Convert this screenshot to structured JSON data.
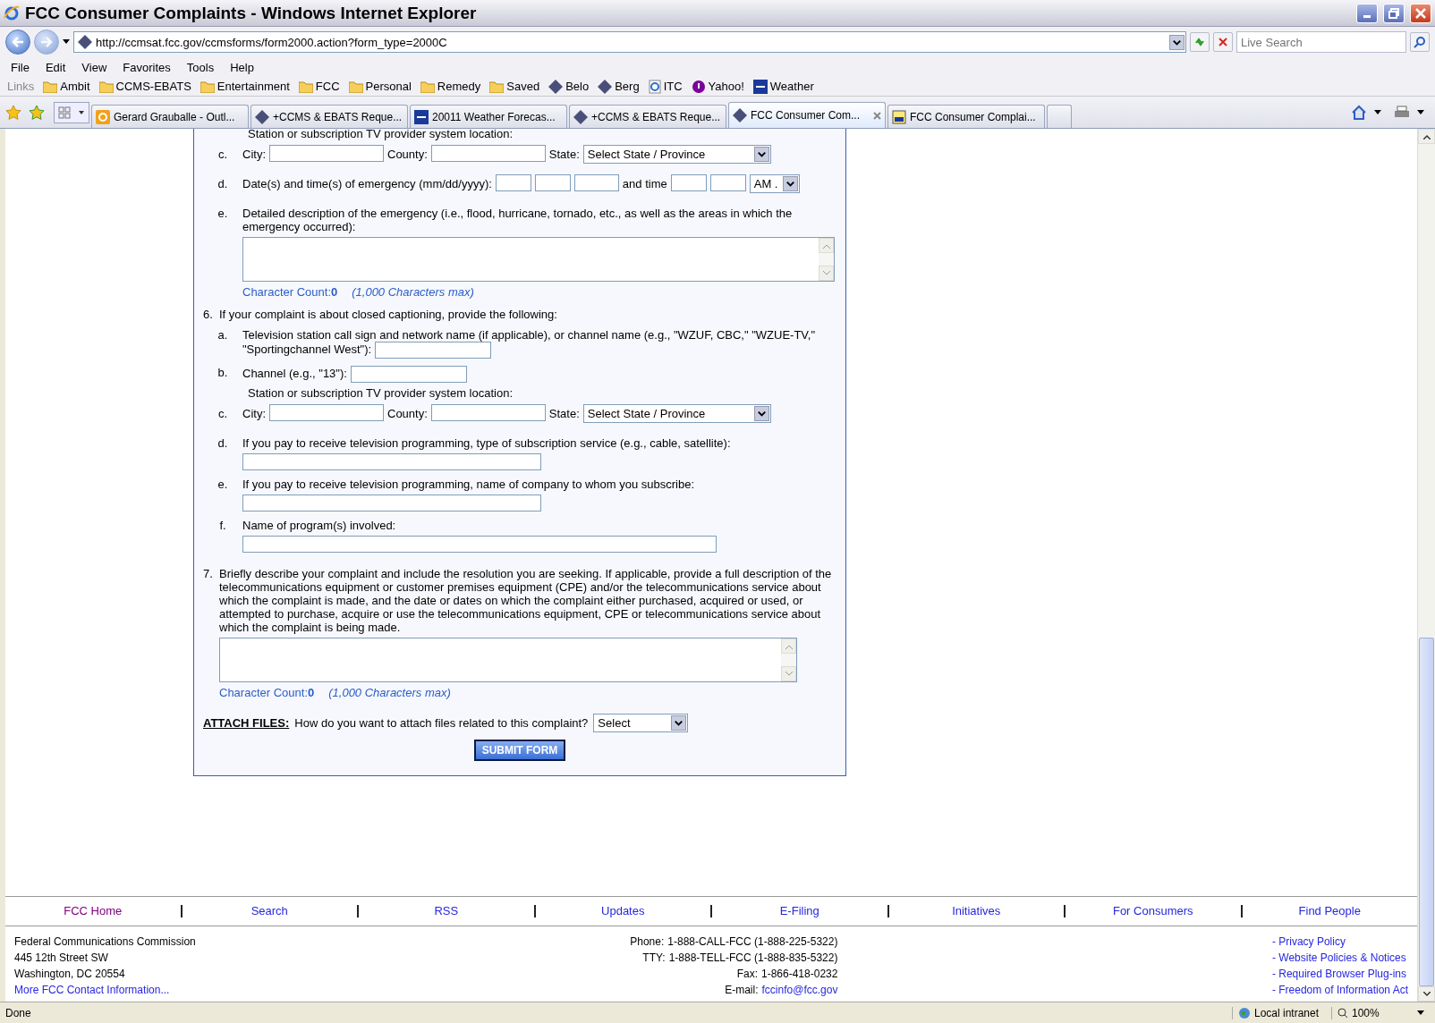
{
  "window": {
    "title": "FCC Consumer Complaints - Windows Internet Explorer"
  },
  "address": {
    "url": "http://ccmsat.fcc.gov/ccmsforms/form2000.action?form_type=2000C",
    "search_placeholder": "Live Search"
  },
  "menu": [
    "File",
    "Edit",
    "View",
    "Favorites",
    "Tools",
    "Help"
  ],
  "links_bar": {
    "label": "Links",
    "items": [
      {
        "label": "Ambit",
        "kind": "folder"
      },
      {
        "label": "CCMS-EBATS",
        "kind": "folder"
      },
      {
        "label": "Entertainment",
        "kind": "folder"
      },
      {
        "label": "FCC",
        "kind": "folder"
      },
      {
        "label": "Personal",
        "kind": "folder"
      },
      {
        "label": "Remedy",
        "kind": "folder"
      },
      {
        "label": "Saved",
        "kind": "folder"
      },
      {
        "label": "Belo",
        "kind": "site"
      },
      {
        "label": "Berg",
        "kind": "site"
      },
      {
        "label": "ITC",
        "kind": "ie"
      },
      {
        "label": "Yahoo!",
        "kind": "yahoo"
      },
      {
        "label": "Weather",
        "kind": "twc"
      }
    ]
  },
  "tabs": [
    {
      "label": "Gerard Grauballe - Outl...",
      "kind": "outlook",
      "selected": false
    },
    {
      "label": "+CCMS & EBATS Reque...",
      "kind": "site",
      "selected": false
    },
    {
      "label": "20011 Weather Forecas...",
      "kind": "twc",
      "selected": false
    },
    {
      "label": "+CCMS & EBATS Reque...",
      "kind": "site",
      "selected": false
    },
    {
      "label": "FCC Consumer Com...",
      "kind": "site",
      "selected": true
    },
    {
      "label": "FCC Consumer Complai...",
      "kind": "fcc",
      "selected": false
    }
  ],
  "form": {
    "section_5": [
      {
        "kind": "note",
        "text": "Station or subscription TV provider system location:"
      },
      {
        "kind": "location",
        "letter": "c.",
        "city": "City:",
        "county": "County:",
        "state": "State:",
        "select": "Select State / Province"
      },
      {
        "kind": "datetime",
        "letter": "d.",
        "label": "Date(s) and time(s) of emergency (mm/dd/yyyy):",
        "time_label": "and time",
        "ampm": "AM ."
      },
      {
        "kind": "textarea",
        "letter": "e.",
        "label": "Detailed description of the emergency (i.e., flood, hurricane, tornado, etc., as well as the areas in which the emergency occurred):",
        "count_label": "Character Count:",
        "count": "0",
        "max": "(1,000 Characters max)"
      }
    ],
    "question_6": {
      "number": "6.",
      "text": "If your complaint is about closed captioning, provide the following:",
      "items": [
        {
          "kind": "inline",
          "letter": "a.",
          "label": "Television station call sign and network name (if applicable), or channel name (e.g., \"WZUF, CBC,\" \"WZUE-TV,\" \"Sportingchannel West\"):"
        },
        {
          "kind": "inline",
          "letter": "b.",
          "label": "Channel (e.g., \"13\"):"
        },
        {
          "kind": "note",
          "text": "Station or subscription TV provider system location:"
        },
        {
          "kind": "location",
          "letter": "c.",
          "city": "City:",
          "county": "County:",
          "state": "State:",
          "select": "Select State / Province"
        },
        {
          "kind": "block",
          "letter": "d.",
          "label": "If you pay to receive television programming, type of subscription service (e.g., cable, satellite):"
        },
        {
          "kind": "block",
          "letter": "e.",
          "label": "If you pay to receive television programming, name of company to whom you subscribe:"
        },
        {
          "kind": "wide_block",
          "letter": "f.",
          "label": "Name of program(s) involved:"
        }
      ]
    },
    "question_7": {
      "number": "7.",
      "text": "Briefly describe your complaint and include the resolution you are seeking. If applicable, provide a full description of the telecommunications equipment or customer premises equipment (CPE) and/or the telecommunications service about which the complaint is made, and the date or dates on which the complaint either purchased, acquired or used, or attempted to purchase, acquire or use the telecommunications equipment, CPE or telecommunications service about which the complaint is being made.",
      "count_label": "Character Count:",
      "count": "0",
      "max": "(1,000 Characters max)"
    },
    "attach": {
      "label": "ATTACH FILES:",
      "question": "How do you want to attach files related to this complaint?",
      "select": "Select"
    },
    "submit": "SUBMIT FORM"
  },
  "footer_nav": [
    {
      "label": "FCC Home",
      "visited": true
    },
    {
      "label": "Search",
      "visited": false
    },
    {
      "label": "RSS",
      "visited": false
    },
    {
      "label": "Updates",
      "visited": false
    },
    {
      "label": "E-Filing",
      "visited": false
    },
    {
      "label": "Initiatives",
      "visited": false
    },
    {
      "label": "For Consumers",
      "visited": false
    },
    {
      "label": "Find People",
      "visited": false
    }
  ],
  "footer": {
    "address": [
      "Federal Communications Commission",
      "445 12th Street SW",
      "Washington, DC 20554"
    ],
    "contact_link": "More FCC Contact Information...",
    "contacts": [
      {
        "label": "Phone:",
        "value": "1-888-CALL-FCC (1-888-225-5322)",
        "kind": "text"
      },
      {
        "label": "TTY:",
        "value": "1-888-TELL-FCC (1-888-835-5322)",
        "kind": "text"
      },
      {
        "label": "Fax:",
        "value": "1-866-418-0232",
        "kind": "text"
      },
      {
        "label": "E-mail:",
        "value": "fccinfo@fcc.gov",
        "kind": "link"
      }
    ],
    "policies": [
      "- Privacy Policy",
      "- Website Policies & Notices",
      "- Required Browser Plug-ins",
      "- Freedom of Information Act"
    ]
  },
  "status_bar": {
    "text": "Done",
    "zone": "Local intranet",
    "zoom": "100%"
  }
}
